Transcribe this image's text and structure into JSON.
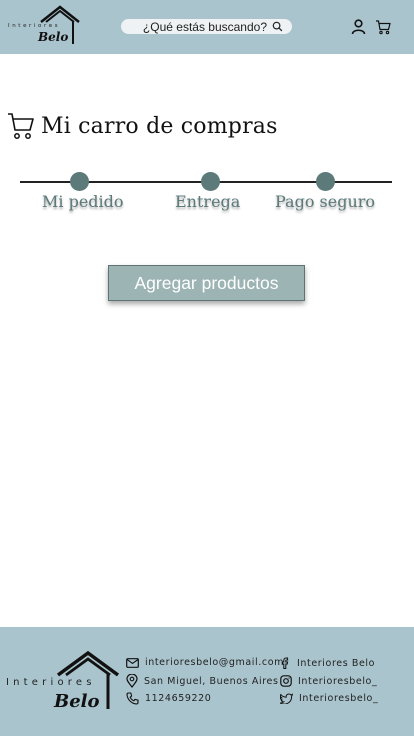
{
  "header": {
    "logo": {
      "word": "Interiores",
      "belo": "Belo"
    },
    "search": {
      "placeholder": "¿Qué estás buscando?"
    }
  },
  "page": {
    "title": "Mi carro de compras"
  },
  "stepper": {
    "steps": [
      {
        "label": "Mi pedido"
      },
      {
        "label": "Entrega"
      },
      {
        "label": "Pago seguro"
      }
    ]
  },
  "cart": {
    "add_products_label": "Agregar productos"
  },
  "footer": {
    "logo": {
      "word": "Interiores",
      "belo": "Belo"
    },
    "email": "interioresbelo@gmail.com",
    "address": "San Miguel, Buenos Aires",
    "phone": "1124659220",
    "facebook": "Interiores Belo",
    "instagram": "Interioresbelo_",
    "twitter": "Interioresbelo_"
  },
  "colors": {
    "header_bg": "#aac4cd",
    "accent": "#5c7a7a",
    "button_bg": "#9db4b4"
  }
}
